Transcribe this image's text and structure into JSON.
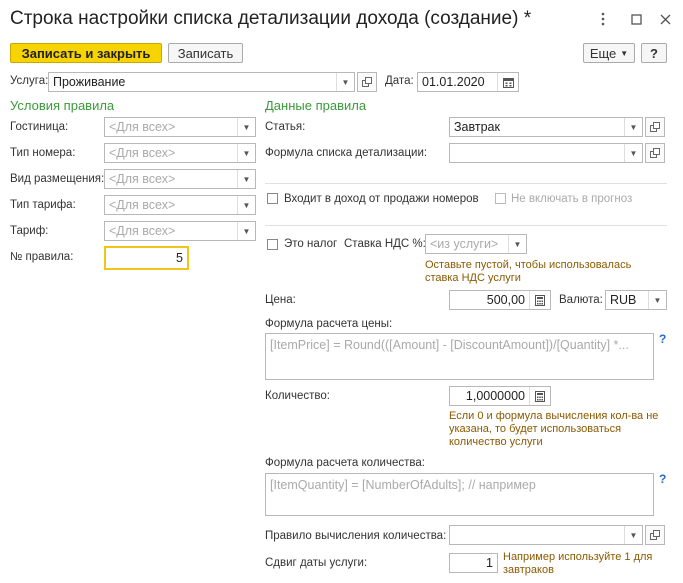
{
  "window": {
    "title": "Строка настройки списка детализации дохода (создание) *",
    "more_icon": "more-vertical-icon",
    "maximize_icon": "maximize-icon",
    "close_icon": "close-icon"
  },
  "toolbar": {
    "save_close_label": "Записать и закрыть",
    "save_label": "Записать",
    "more_label": "Еще",
    "help_label": "?"
  },
  "service": {
    "label": "Услуга:",
    "value": "Проживание"
  },
  "date": {
    "label": "Дата:",
    "value": "01.01.2020"
  },
  "left": {
    "section": "Условия правила",
    "hotel": {
      "label": "Гостиница:",
      "placeholder": "<Для всех>"
    },
    "room_type": {
      "label": "Тип номера:",
      "placeholder": "<Для всех>"
    },
    "accommodation_type": {
      "label": "Вид размещения:",
      "placeholder": "<Для всех>"
    },
    "rate_type": {
      "label": "Тип тарифа:",
      "placeholder": "<Для всех>"
    },
    "rate": {
      "label": "Тариф:",
      "placeholder": "<Для всех>"
    },
    "rule_no": {
      "label": "№ правила:",
      "value": "5"
    }
  },
  "right": {
    "section": "Данные правила",
    "article": {
      "label": "Статья:",
      "value": "Завтрак"
    },
    "detail_formula": {
      "label": "Формула списка детализации:",
      "value": ""
    },
    "included_in_room_revenue": {
      "label": "Входит в доход от продажи номеров",
      "checked": false
    },
    "exclude_from_forecast": {
      "label": "Не включать в прогноз",
      "checked": false
    },
    "is_tax": {
      "label": "Это налог",
      "checked": false
    },
    "vat_rate": {
      "label": "Ставка НДС %:",
      "placeholder": "<из услуги>"
    },
    "vat_hint": "Оставьте пустой, чтобы использовалась ставка НДС услуги",
    "price": {
      "label": "Цена:",
      "value": "500,00"
    },
    "currency": {
      "label": "Валюта:",
      "value": "RUB"
    },
    "price_formula": {
      "label": "Формула расчета цены:",
      "placeholder": "[ItemPrice] = Round(([Amount] - [DiscountAmount])/[Quantity] *..."
    },
    "quantity": {
      "label": "Количество:",
      "value": "1,0000000"
    },
    "quantity_hint": "Если 0 и формула вычисления кол-ва не указана, то будет использоваться количество услуги",
    "quantity_formula": {
      "label": "Формула расчета количества:",
      "placeholder": "[ItemQuantity] = [NumberOfAdults]; // например"
    },
    "quantity_rule": {
      "label": "Правило вычисления количества:",
      "value": ""
    },
    "date_shift": {
      "label": "Сдвиг даты услуги:",
      "value": "1"
    },
    "date_shift_hint": "Например используйте 1 для завтраков",
    "help_mark": "?"
  },
  "colors": {
    "accent": "#f7d300",
    "section": "#3a9a3a",
    "hint": "#8a5a00",
    "focus": "#f0c419"
  }
}
